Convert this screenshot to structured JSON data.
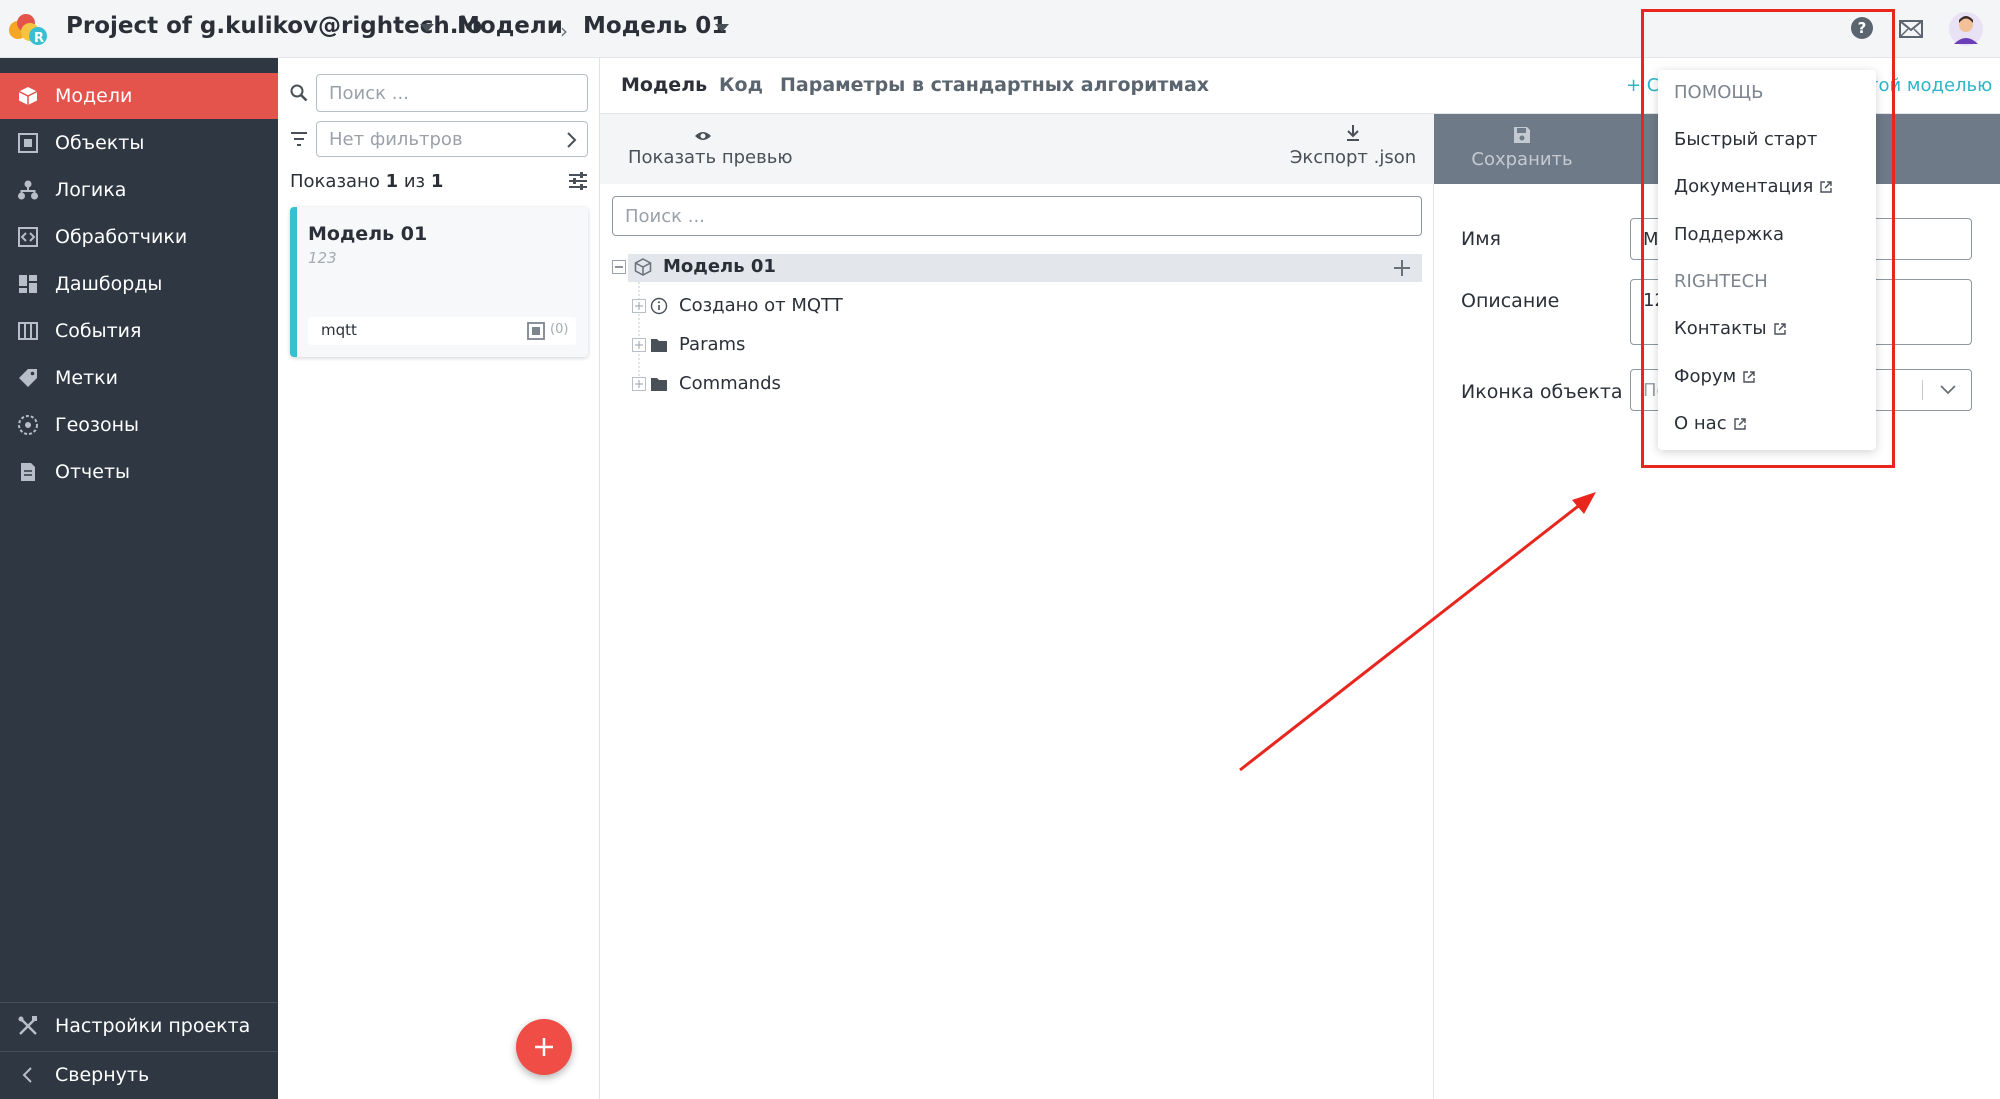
{
  "header": {
    "project": "Project of g.kulikov@rightech.io",
    "section": "Модели",
    "model": "Модель 01"
  },
  "sidebar": {
    "items": [
      {
        "label": "Модели",
        "icon": "cube-icon",
        "active": true
      },
      {
        "label": "Объекты",
        "icon": "square-icon"
      },
      {
        "label": "Логика",
        "icon": "hierarchy-icon"
      },
      {
        "label": "Обработчики",
        "icon": "code-icon"
      },
      {
        "label": "Дашборды",
        "icon": "dashboard-icon"
      },
      {
        "label": "События",
        "icon": "columns-icon"
      },
      {
        "label": "Метки",
        "icon": "tag-icon"
      },
      {
        "label": "Геозоны",
        "icon": "geozone-icon"
      },
      {
        "label": "Отчеты",
        "icon": "document-icon"
      }
    ],
    "settings": "Настройки проекта",
    "collapse": "Свернуть"
  },
  "list": {
    "search_placeholder": "Поиск ...",
    "filter_placeholder": "Нет фильтров",
    "shown_prefix": "Показано",
    "shown_count": "1",
    "shown_of": "из",
    "shown_total": "1",
    "card": {
      "title": "Модель 01",
      "subtitle": "123",
      "tag": "mqtt",
      "count": "(0)"
    }
  },
  "tabs": [
    "Модель",
    "Код",
    "Параметры в стандартных алгоритмах"
  ],
  "link_left": "+ Со",
  "link_right": "той моделью",
  "toolbar": {
    "preview": "Показать превью",
    "export": "Экспорт .json",
    "save": "Сохранить"
  },
  "tree": {
    "search_placeholder": "Поиск ...",
    "root": "Модель 01",
    "children": [
      "Создано от MQTT",
      "Params",
      "Commands"
    ]
  },
  "form": {
    "name_label": "Имя",
    "name_value": "М",
    "desc_label": "Описание",
    "desc_value": "12",
    "icon_label": "Иконка объекта",
    "icon_placeholder": "По"
  },
  "help_menu": {
    "help_title": "ПОМОЩЬ",
    "quick_start": "Быстрый старт",
    "docs": "Документация",
    "support": "Поддержка",
    "company_title": "RIGHTECH",
    "contacts": "Контакты",
    "forum": "Форум",
    "about": "О нас"
  },
  "colors": {
    "sidebar_bg": "#2e3742",
    "active_red": "#e4544c",
    "card_accent": "#38bfd3",
    "annotation_red": "#e8261e"
  }
}
